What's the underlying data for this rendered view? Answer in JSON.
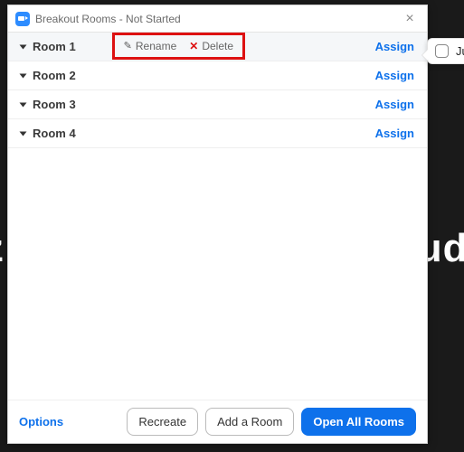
{
  "window": {
    "title": "Breakout Rooms - Not Started"
  },
  "rooms": [
    {
      "name": "Room 1",
      "assign": "Assign",
      "rename": "Rename",
      "delete": "Delete",
      "selected": true
    },
    {
      "name": "Room 2",
      "assign": "Assign"
    },
    {
      "name": "Room 3",
      "assign": "Assign"
    },
    {
      "name": "Room 4",
      "assign": "Assign"
    }
  ],
  "footer": {
    "options": "Options",
    "recreate": "Recreate",
    "add_room": "Add a Room",
    "open_all": "Open All Rooms"
  },
  "tooltip": {
    "participant": "Judy"
  },
  "background": {
    "right_fragment": "udy",
    "left_fragment": "z"
  },
  "colors": {
    "accent": "#0E71EB",
    "highlight_box": "#d11"
  }
}
